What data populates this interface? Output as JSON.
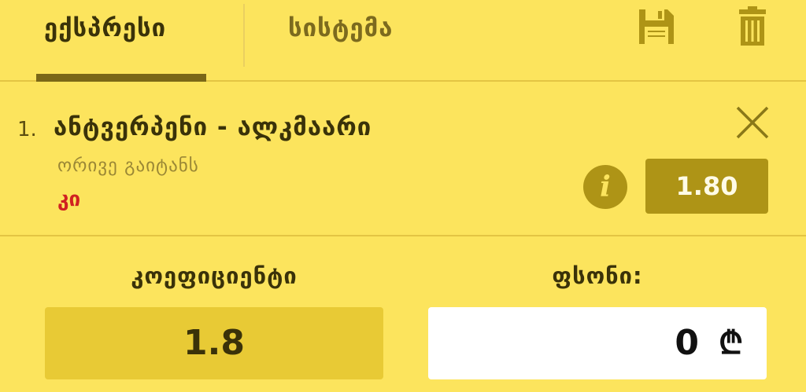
{
  "tabs": {
    "express": "ექსპრესი",
    "system": "სისტემა"
  },
  "toolbar": {
    "save_icon": "floppy-disk-icon",
    "delete_icon": "trash-icon"
  },
  "bet": {
    "number": "1.",
    "event": "ანტვერპენი - ალკმაარი",
    "market": "ორივე გაიტანს",
    "pick": "კი",
    "odds": "1.80",
    "info_icon": "info-icon",
    "close_icon": "close-icon"
  },
  "summary": {
    "coefficient_label": "კოეფიციენტი",
    "coefficient_value": "1.8",
    "stake_label": "ფსონი:",
    "stake_value": "0",
    "currency": "₾"
  },
  "colors": {
    "background": "#fce45d",
    "accent": "#ae9416",
    "pick": "#d02121"
  }
}
